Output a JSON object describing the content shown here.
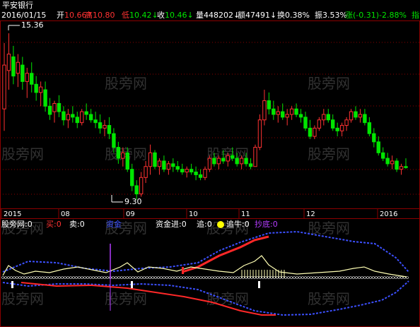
{
  "stock": {
    "name": "平安银行"
  },
  "header": {
    "date": "2016/01/15",
    "fields": [
      {
        "label": "开",
        "value": "10.66",
        "arrow": "↑",
        "label_color": "#FFFFFF",
        "value_color": "#FF3232"
      },
      {
        "label": "高",
        "value": "10.80",
        "arrow": "",
        "label_color": "#FF3232",
        "value_color": "#FF3232"
      },
      {
        "label": "低",
        "value": "10.42",
        "arrow": "↓",
        "label_color": "#FF3232",
        "value_color": "#00E600"
      },
      {
        "label": "收",
        "value": "10.46",
        "arrow": "↓",
        "label_color": "#FFFFFF",
        "value_color": "#00E600"
      },
      {
        "label": "量",
        "value": "448202",
        "arrow": "↓",
        "label_color": "#FFFFFF",
        "value_color": "#FFFFFF"
      },
      {
        "label": "额",
        "value": "47491",
        "arrow": "↓",
        "label_color": "#FFFFFF",
        "value_color": "#FFFFFF"
      },
      {
        "label": "换",
        "value": "0.38%",
        "arrow": "",
        "label_color": "#FFFFFF",
        "value_color": "#FFFFFF"
      },
      {
        "label": "振",
        "value": "3.53%",
        "arrow": "",
        "label_color": "#FFFFFF",
        "value_color": "#FFFFFF"
      },
      {
        "label": "涨",
        "value": "(-0.31)-2.88%",
        "arrow": "",
        "label_color": "#00E600",
        "value_color": "#00E600"
      },
      {
        "label": "",
        "value": "指",
        "arrow": "",
        "label_color": "#00E600",
        "value_color": "#00E600"
      }
    ]
  },
  "price_markers": {
    "high": "15.36",
    "low": "9.30"
  },
  "x_axis": {
    "labels": [
      "2015",
      "08",
      "09",
      "10",
      "11",
      "12",
      "2016"
    ]
  },
  "indicator_bar": {
    "items": [
      {
        "text": "股旁网:0",
        "color": "#FFFFFF"
      },
      {
        "text": "买:0",
        "color": "#FF3232"
      },
      {
        "text": "卖:0",
        "color": "#FFFFFF"
      },
      {
        "text": "资金",
        "color": "#3C50FF"
      },
      {
        "text": "资金进:0",
        "color": "#FFFFFF"
      },
      {
        "text": "追:0",
        "color": "#FFFFFF"
      },
      {
        "text": "追牛:0",
        "color": "#FFFFFF"
      },
      {
        "text": "抄底:0",
        "color": "#B43CFF"
      }
    ]
  },
  "watermark": "股旁网",
  "colors": {
    "background": "#000000",
    "up": "#FF3232",
    "down": "#00E600",
    "grid": "#8B0000",
    "axis_text": "#C0C0C0",
    "date_label": "#FFFFFF",
    "yellow_line": "#FFFFB4",
    "blue_line": "#3C50FF",
    "red_line": "#FF2828",
    "purple": "#B43CFF",
    "watermark": "#5A5A5A"
  },
  "chart_data": {
    "type": "candlestick",
    "price_range": [
      9.0,
      15.8
    ],
    "candles": [
      {
        "o": 12.6,
        "h": 15.0,
        "l": 11.8,
        "c": 14.2
      },
      {
        "o": 14.0,
        "h": 15.36,
        "l": 13.3,
        "c": 14.6
      },
      {
        "o": 14.5,
        "h": 14.9,
        "l": 13.5,
        "c": 13.8
      },
      {
        "o": 13.9,
        "h": 14.6,
        "l": 13.4,
        "c": 14.3
      },
      {
        "o": 14.2,
        "h": 14.5,
        "l": 13.3,
        "c": 13.6
      },
      {
        "o": 13.6,
        "h": 14.1,
        "l": 13.0,
        "c": 13.9
      },
      {
        "o": 13.9,
        "h": 14.3,
        "l": 13.2,
        "c": 13.5
      },
      {
        "o": 13.5,
        "h": 13.8,
        "l": 12.9,
        "c": 13.2
      },
      {
        "o": 13.2,
        "h": 13.6,
        "l": 12.7,
        "c": 13.4
      },
      {
        "o": 13.3,
        "h": 13.6,
        "l": 12.5,
        "c": 12.7
      },
      {
        "o": 12.7,
        "h": 13.0,
        "l": 12.2,
        "c": 12.4
      },
      {
        "o": 12.5,
        "h": 12.9,
        "l": 12.1,
        "c": 12.8
      },
      {
        "o": 12.8,
        "h": 13.1,
        "l": 12.3,
        "c": 12.5
      },
      {
        "o": 12.5,
        "h": 12.7,
        "l": 12.0,
        "c": 12.2
      },
      {
        "o": 12.2,
        "h": 12.6,
        "l": 11.9,
        "c": 12.4
      },
      {
        "o": 12.4,
        "h": 12.7,
        "l": 12.1,
        "c": 12.3
      },
      {
        "o": 12.3,
        "h": 12.5,
        "l": 11.9,
        "c": 12.1
      },
      {
        "o": 12.1,
        "h": 12.6,
        "l": 12.0,
        "c": 12.5
      },
      {
        "o": 12.5,
        "h": 12.8,
        "l": 12.2,
        "c": 12.4
      },
      {
        "o": 12.4,
        "h": 12.6,
        "l": 12.1,
        "c": 12.2
      },
      {
        "o": 12.2,
        "h": 12.5,
        "l": 11.9,
        "c": 12.1
      },
      {
        "o": 12.1,
        "h": 12.4,
        "l": 11.7,
        "c": 11.9
      },
      {
        "o": 11.9,
        "h": 12.2,
        "l": 11.6,
        "c": 12.0
      },
      {
        "o": 12.0,
        "h": 12.3,
        "l": 11.5,
        "c": 11.7
      },
      {
        "o": 11.7,
        "h": 11.9,
        "l": 11.0,
        "c": 11.2
      },
      {
        "o": 11.2,
        "h": 11.4,
        "l": 10.6,
        "c": 10.8
      },
      {
        "o": 10.8,
        "h": 11.2,
        "l": 10.5,
        "c": 11.0
      },
      {
        "o": 11.0,
        "h": 11.2,
        "l": 10.3,
        "c": 10.4
      },
      {
        "o": 10.4,
        "h": 10.6,
        "l": 9.6,
        "c": 9.8
      },
      {
        "o": 9.8,
        "h": 10.0,
        "l": 9.3,
        "c": 9.5
      },
      {
        "o": 9.5,
        "h": 10.3,
        "l": 9.4,
        "c": 10.1
      },
      {
        "o": 10.1,
        "h": 10.7,
        "l": 9.9,
        "c": 10.5
      },
      {
        "o": 10.5,
        "h": 11.3,
        "l": 10.2,
        "c": 11.0
      },
      {
        "o": 11.0,
        "h": 11.1,
        "l": 10.4,
        "c": 10.5
      },
      {
        "o": 10.5,
        "h": 10.8,
        "l": 10.2,
        "c": 10.7
      },
      {
        "o": 10.7,
        "h": 10.9,
        "l": 10.3,
        "c": 10.4
      },
      {
        "o": 10.4,
        "h": 10.7,
        "l": 10.2,
        "c": 10.6
      },
      {
        "o": 10.6,
        "h": 10.8,
        "l": 10.3,
        "c": 10.5
      },
      {
        "o": 10.5,
        "h": 10.7,
        "l": 10.3,
        "c": 10.4
      },
      {
        "o": 10.4,
        "h": 10.6,
        "l": 10.2,
        "c": 10.3
      },
      {
        "o": 10.3,
        "h": 10.5,
        "l": 10.1,
        "c": 10.4
      },
      {
        "o": 10.4,
        "h": 10.6,
        "l": 10.2,
        "c": 10.3
      },
      {
        "o": 10.3,
        "h": 10.5,
        "l": 10.0,
        "c": 10.2
      },
      {
        "o": 10.2,
        "h": 10.4,
        "l": 10.0,
        "c": 10.1
      },
      {
        "o": 10.1,
        "h": 10.5,
        "l": 10.0,
        "c": 10.4
      },
      {
        "o": 10.4,
        "h": 10.9,
        "l": 10.3,
        "c": 10.8
      },
      {
        "o": 10.8,
        "h": 11.0,
        "l": 10.5,
        "c": 10.6
      },
      {
        "o": 10.6,
        "h": 10.9,
        "l": 10.4,
        "c": 10.8
      },
      {
        "o": 10.8,
        "h": 11.1,
        "l": 10.6,
        "c": 10.7
      },
      {
        "o": 10.7,
        "h": 11.0,
        "l": 10.5,
        "c": 10.9
      },
      {
        "o": 10.9,
        "h": 11.2,
        "l": 10.7,
        "c": 10.8
      },
      {
        "o": 10.8,
        "h": 11.0,
        "l": 10.5,
        "c": 10.6
      },
      {
        "o": 10.6,
        "h": 10.9,
        "l": 10.4,
        "c": 10.8
      },
      {
        "o": 10.8,
        "h": 11.0,
        "l": 10.5,
        "c": 10.6
      },
      {
        "o": 10.6,
        "h": 10.8,
        "l": 10.4,
        "c": 10.5
      },
      {
        "o": 10.5,
        "h": 11.3,
        "l": 10.5,
        "c": 11.2
      },
      {
        "o": 11.2,
        "h": 12.4,
        "l": 11.1,
        "c": 12.2
      },
      {
        "o": 12.2,
        "h": 13.3,
        "l": 12.0,
        "c": 12.9
      },
      {
        "o": 12.9,
        "h": 13.2,
        "l": 12.4,
        "c": 12.6
      },
      {
        "o": 12.6,
        "h": 12.9,
        "l": 12.2,
        "c": 12.4
      },
      {
        "o": 12.4,
        "h": 12.7,
        "l": 12.1,
        "c": 12.5
      },
      {
        "o": 12.5,
        "h": 12.8,
        "l": 12.2,
        "c": 12.3
      },
      {
        "o": 12.3,
        "h": 12.6,
        "l": 12.0,
        "c": 12.4
      },
      {
        "o": 12.4,
        "h": 12.7,
        "l": 12.2,
        "c": 12.6
      },
      {
        "o": 12.6,
        "h": 12.8,
        "l": 12.3,
        "c": 12.4
      },
      {
        "o": 12.4,
        "h": 12.6,
        "l": 12.1,
        "c": 12.3
      },
      {
        "o": 12.3,
        "h": 12.5,
        "l": 11.8,
        "c": 11.9
      },
      {
        "o": 11.9,
        "h": 12.2,
        "l": 11.5,
        "c": 11.6
      },
      {
        "o": 11.6,
        "h": 12.0,
        "l": 11.5,
        "c": 11.9
      },
      {
        "o": 11.9,
        "h": 12.3,
        "l": 11.8,
        "c": 12.2
      },
      {
        "o": 12.2,
        "h": 12.6,
        "l": 12.0,
        "c": 12.4
      },
      {
        "o": 12.4,
        "h": 12.6,
        "l": 12.1,
        "c": 12.2
      },
      {
        "o": 12.2,
        "h": 12.4,
        "l": 11.8,
        "c": 11.9
      },
      {
        "o": 11.9,
        "h": 12.1,
        "l": 11.6,
        "c": 11.8
      },
      {
        "o": 11.8,
        "h": 12.1,
        "l": 11.6,
        "c": 12.0
      },
      {
        "o": 12.0,
        "h": 12.3,
        "l": 11.8,
        "c": 12.2
      },
      {
        "o": 12.2,
        "h": 12.6,
        "l": 12.1,
        "c": 12.5
      },
      {
        "o": 12.5,
        "h": 12.7,
        "l": 12.2,
        "c": 12.3
      },
      {
        "o": 12.3,
        "h": 12.6,
        "l": 12.1,
        "c": 12.4
      },
      {
        "o": 12.4,
        "h": 12.6,
        "l": 12.0,
        "c": 12.1
      },
      {
        "o": 12.1,
        "h": 12.3,
        "l": 11.6,
        "c": 11.7
      },
      {
        "o": 11.7,
        "h": 11.9,
        "l": 11.2,
        "c": 11.4
      },
      {
        "o": 11.4,
        "h": 11.6,
        "l": 10.9,
        "c": 11.0
      },
      {
        "o": 11.0,
        "h": 11.2,
        "l": 10.7,
        "c": 10.8
      },
      {
        "o": 10.8,
        "h": 11.0,
        "l": 10.5,
        "c": 10.6
      },
      {
        "o": 10.6,
        "h": 10.9,
        "l": 10.4,
        "c": 10.7
      },
      {
        "o": 10.7,
        "h": 10.8,
        "l": 10.3,
        "c": 10.4
      },
      {
        "o": 10.4,
        "h": 10.6,
        "l": 10.2,
        "c": 10.5
      },
      {
        "o": 10.5,
        "h": 10.8,
        "l": 10.42,
        "c": 10.46
      }
    ]
  }
}
